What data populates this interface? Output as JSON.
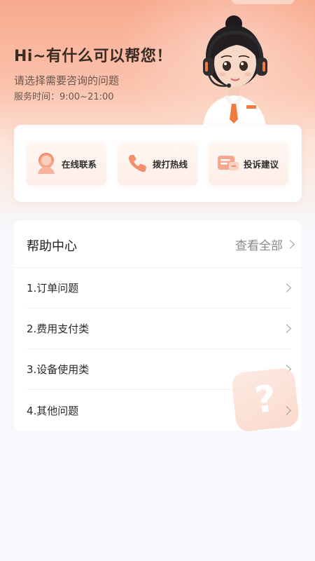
{
  "header": {
    "greeting": "Hi~有什么可以帮您！",
    "subtitle": "请选择需要咨询的问题",
    "hours": "服务时间：9:00~21:00"
  },
  "quick_actions": [
    {
      "label": "在线联系",
      "icon": "agent-icon"
    },
    {
      "label": "拨打热线",
      "icon": "phone-icon"
    },
    {
      "label": "投诉建议",
      "icon": "complaint-card-icon"
    }
  ],
  "help_center": {
    "title": "帮助中心",
    "view_all": "查看全部",
    "items": [
      {
        "label": "1.订单问题"
      },
      {
        "label": "2.费用支付类"
      },
      {
        "label": "3.设备使用类"
      },
      {
        "label": "4.其他问题"
      }
    ]
  },
  "colors": {
    "accent": "#f26b45",
    "hero_top": "#f8a98e",
    "background": "#f6f8fb"
  }
}
